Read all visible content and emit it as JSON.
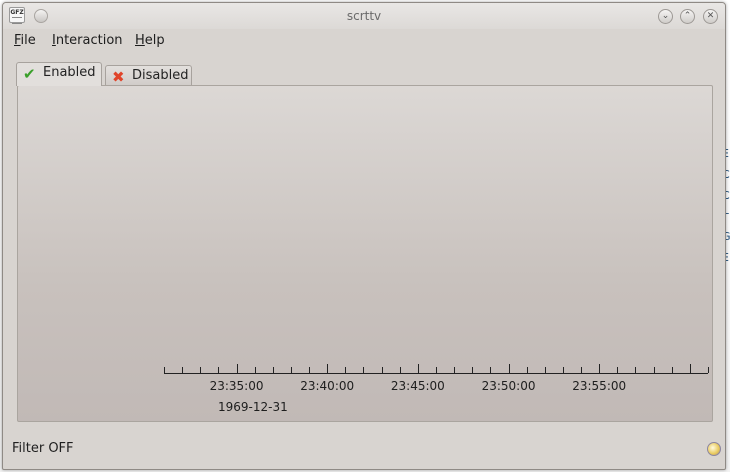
{
  "window": {
    "title": "scrttv",
    "app_icon_text": "GFZ"
  },
  "menu": [
    "File",
    "Interaction",
    "Help"
  ],
  "tabs": [
    {
      "label": "Enabled",
      "icon": "checkmark-icon",
      "active": true
    },
    {
      "label": "Disabled",
      "icon": "red-x-icon",
      "active": false
    }
  ],
  "timeline": {
    "tick_labels": [
      "23:35:00",
      "23:40:00",
      "23:45:00",
      "23:50:00",
      "23:55:00"
    ],
    "date": "1969-12-31",
    "first_tick_time": "23:31:00",
    "last_tick_time": "23:61:00",
    "minor_tick_interval_min": 1,
    "major_tick_interval_min": 5
  },
  "status": {
    "text": "Filter OFF",
    "icon": "status-indicator-icon"
  },
  "background_fragments": [
    "E",
    "C",
    "C",
    "T",
    "G",
    "E"
  ]
}
